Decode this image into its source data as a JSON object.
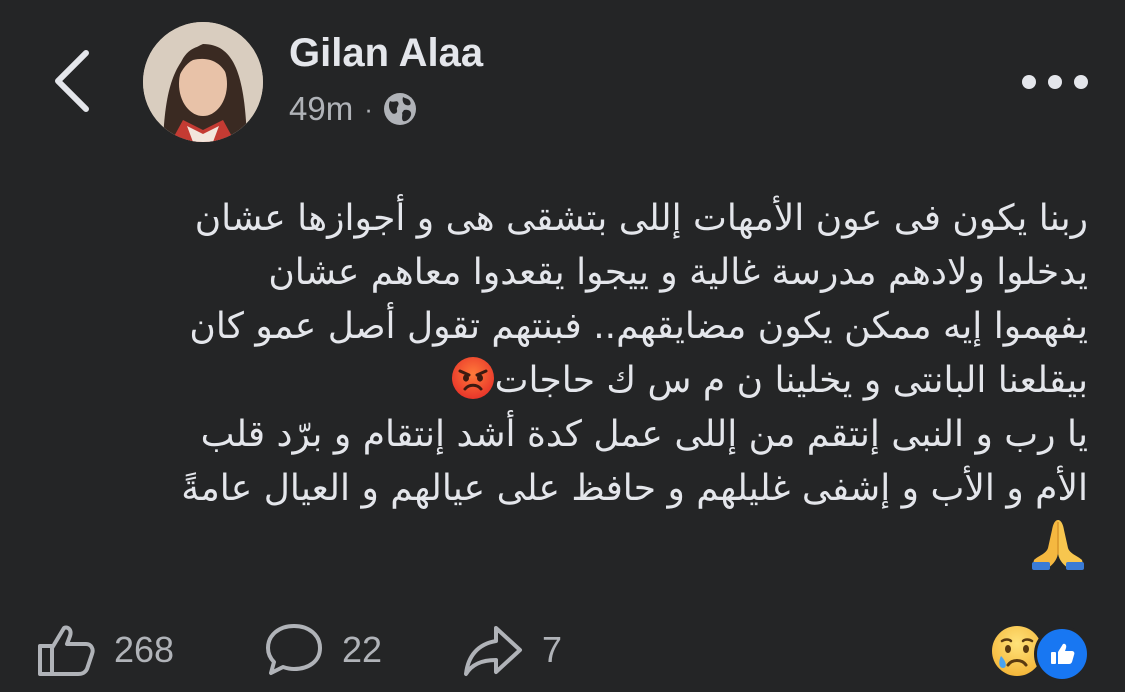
{
  "post": {
    "author": "Gilan Alaa",
    "time": "49m",
    "separator": "·",
    "audience_icon": "globe-icon",
    "lines": [
      "ربنا يكون فى عون الأمهات إللى بتشقى هى و أجوازها عشان",
      "يدخلوا ولادهم مدرسة غالية  و ييجوا يقعدوا معاهم عشان",
      "يفهموا إيه ممكن يكون مضايقهم.. فبنتهم تقول أصل عمو كان",
      "بيقلعنا البانتى و يخلينا ن م س ك حاجات",
      "يا رب و النبى إنتقم من إللى عمل كدة أشد إنتقام و برّد قلب",
      "الأم و الأب و إشفى غليلهم و حافظ على عيالهم و العيال عامةً"
    ],
    "emoji": {
      "angry": "angry-face-emoji",
      "pray": "folded-hands-emoji"
    }
  },
  "reactions": {
    "likes": "268",
    "comments": "22",
    "shares": "7",
    "icons": [
      "sad-reaction-icon",
      "like-reaction-icon"
    ]
  },
  "colors": {
    "background": "#242526",
    "text": "#e4e6eb",
    "secondary": "#b0b3b8",
    "like_blue": "#1877f2"
  }
}
